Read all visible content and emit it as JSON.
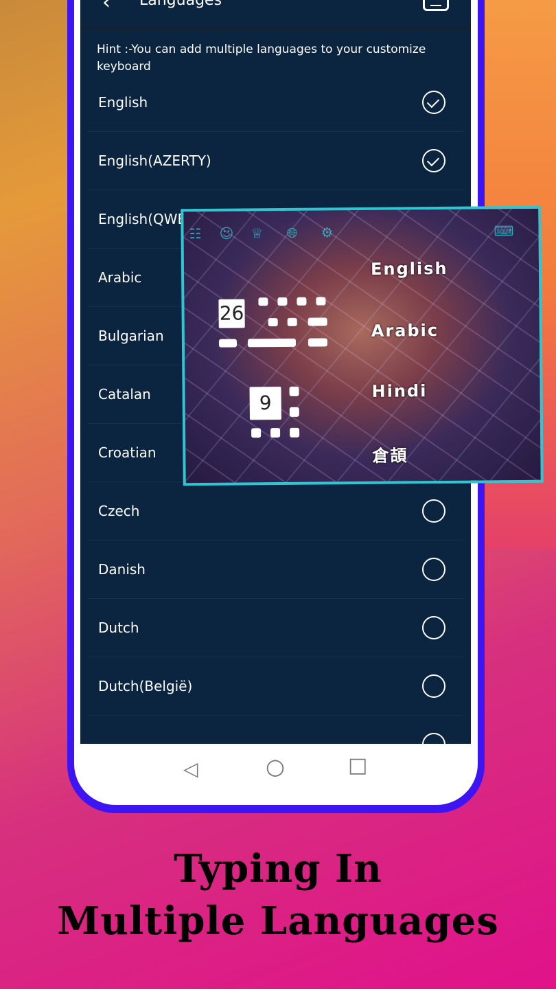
{
  "header": {
    "title": "Languages",
    "back_icon": "chevron-left-icon",
    "keyboard_icon": "keyboard-icon"
  },
  "hint": "Hint :-You can add multiple languages to your customize keyboard",
  "languages": [
    {
      "label": "English",
      "checked": true
    },
    {
      "label": "English(AZERTY)",
      "checked": true
    },
    {
      "label": "English(QWERTZ)",
      "checked": true
    },
    {
      "label": "Arabic",
      "checked": false
    },
    {
      "label": "Bulgarian",
      "checked": false
    },
    {
      "label": "Catalan",
      "checked": false
    },
    {
      "label": "Croatian",
      "checked": false
    },
    {
      "label": "Czech",
      "checked": false
    },
    {
      "label": "Danish",
      "checked": false
    },
    {
      "label": "Dutch",
      "checked": false
    },
    {
      "label": "Dutch(België)",
      "checked": false
    },
    {
      "label": "",
      "checked": false
    }
  ],
  "keyboard_preview": {
    "toolbar_icons": [
      "apps-icon",
      "emoji-icon",
      "theme-icon",
      "globe-icon",
      "gear-icon",
      "keyboard-hide-icon"
    ],
    "key_26": "26",
    "key_9": "9",
    "languages": [
      "English",
      "Arabic",
      "Hindi",
      "倉頡"
    ]
  },
  "nav": {
    "back": "◁",
    "home": "○",
    "recent": "□"
  },
  "caption": {
    "line1": "Typing In",
    "line2": "Multiple Languages"
  },
  "colors": {
    "frame": "#3d14f2",
    "screen": "#0b2540",
    "keyboard_border": "#2fc6d2"
  }
}
